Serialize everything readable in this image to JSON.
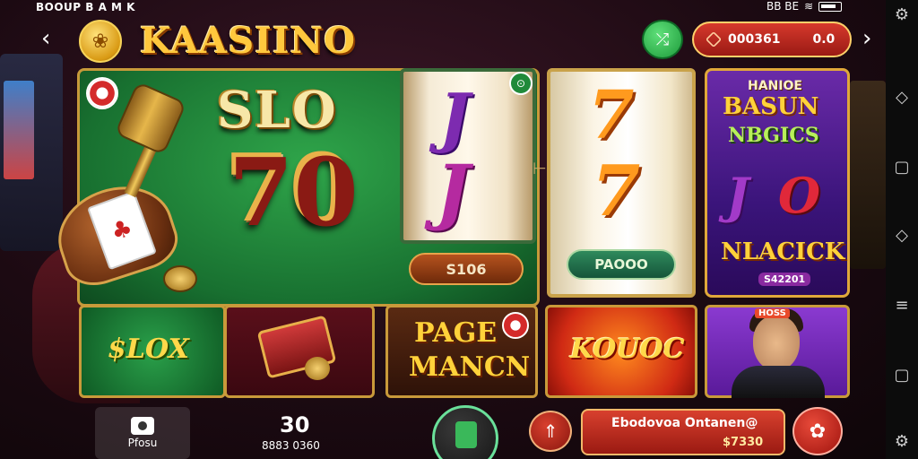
{
  "status_bar": {
    "left_text": "BOOUP B A M K",
    "right_icons": [
      "bluetooth-icon",
      "signal-icon",
      "wifi-icon",
      "battery-icon"
    ],
    "right_text": "BB BE"
  },
  "header": {
    "logo_text": "KAASIINO",
    "balance_id": "000361",
    "balance_value": "0.0",
    "colors": {
      "logo": "#ffc83d",
      "balance_bg": "#c62a20",
      "share_bg": "#2ab04a"
    }
  },
  "main_panel": {
    "title": "SLO",
    "number": "70",
    "bg_color": "#1f8a3a"
  },
  "reel_one": {
    "symbol_top": "J",
    "symbol_bottom": "J",
    "button_label": "S106"
  },
  "reel_two": {
    "symbol_top": "7",
    "symbol_bottom": "7",
    "button_label": "PAOOO"
  },
  "promo_card": {
    "top_label": "HANIOE",
    "title_line1": "BASUN",
    "title_line2": "NBGICS",
    "symbol_left": "J",
    "symbol_right": "O",
    "title_line3": "NLACICK",
    "bottom_label": "S42201"
  },
  "tiles": {
    "green_text": "$LOX",
    "page_line1": "PAGE",
    "page_line2": "MANCN",
    "kouoc_text": "KOUOC",
    "person_badge": "HOSS"
  },
  "bottom_bar": {
    "photo_label": "Pfosu",
    "counter_value": "30",
    "counter_sub": "8883 0360",
    "info_title": "Ebodovoa Ontanen@",
    "info_value": "$7330"
  },
  "nav_icons": [
    "back-arrow-icon",
    "home-icon",
    "recent-apps-icon",
    "menu-icon",
    "settings-icon"
  ]
}
